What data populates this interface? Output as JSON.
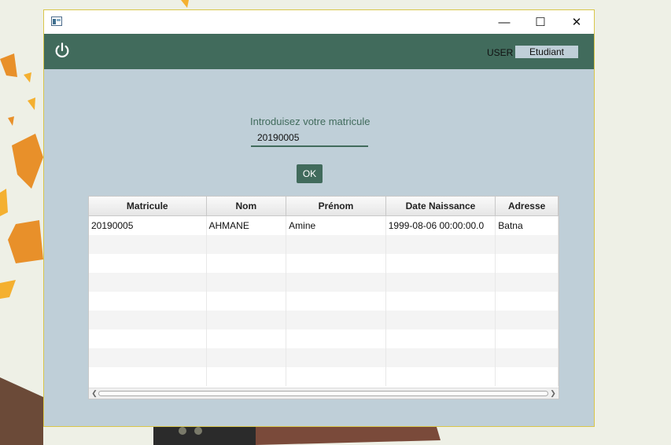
{
  "window": {
    "titlebar": {
      "minimize_glyph": "—",
      "maximize_glyph": "☐",
      "close_glyph": "✕"
    },
    "appbar": {
      "user_label": "USER",
      "role_value": "Etudiant",
      "power_icon": "power-icon"
    },
    "form": {
      "prompt": "Introduisez votre matricule",
      "matricule_value": "20190005",
      "ok_label": "OK"
    },
    "table": {
      "columns": [
        "Matricule",
        "Nom",
        "Prénom",
        "Date Naissance",
        "Adresse"
      ],
      "rows": [
        [
          "20190005",
          "AHMANE",
          "Amine",
          "1999-08-06 00:00:00.0",
          "Batna"
        ]
      ]
    }
  },
  "colors": {
    "accent": "#416b5c",
    "content_bg": "#bfcfd8",
    "window_border": "#d9c64a"
  }
}
